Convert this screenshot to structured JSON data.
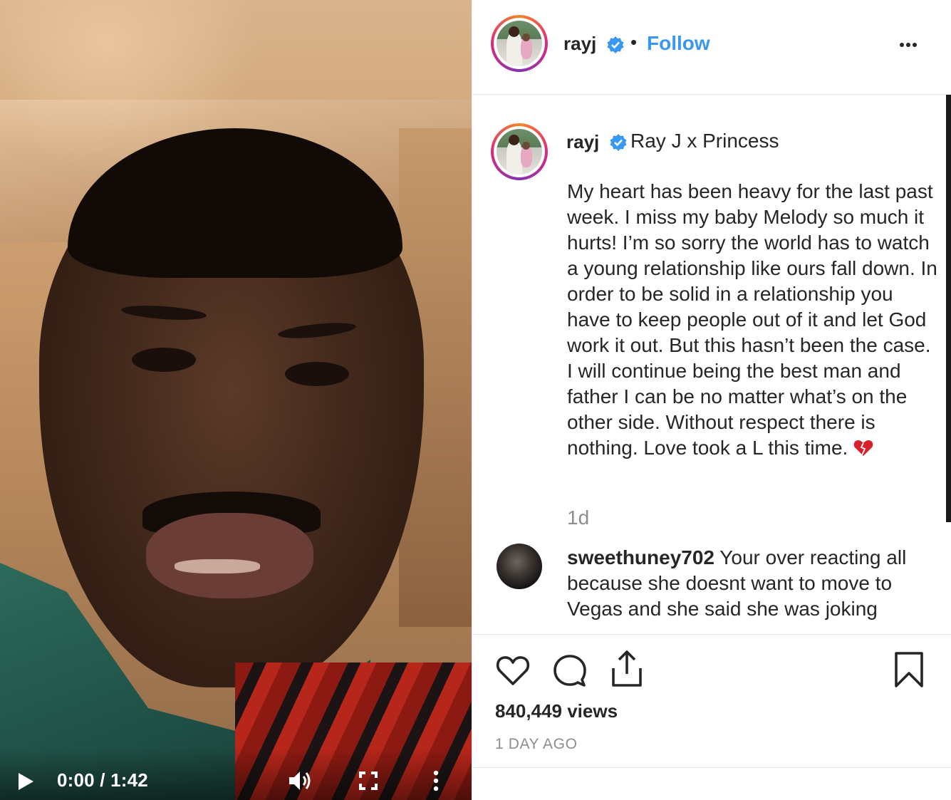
{
  "video": {
    "timecode": "0:00 / 1:42",
    "progress": 0
  },
  "header": {
    "username": "rayj",
    "separator": "•",
    "follow_label": "Follow"
  },
  "caption": {
    "username": "rayj",
    "title": "Ray J x Princess",
    "body": "My heart has been heavy for the last past week. I miss my baby Melody so much it hurts! I’m so sorry the world has to watch a young relationship like ours fall down. In order to be solid in a relationship you have to keep people out of it and let God work it out. But this hasn’t been the case. I will continue being the best man and father I can be no matter what’s on the other side. Without respect there is nothing. Love took a L this time. ",
    "emoji": "broken-heart-icon",
    "time": "1d"
  },
  "comments": [
    {
      "username": "sweethuney702",
      "text": "Your over reacting all because she doesnt want to move to Vegas and she said she was joking"
    }
  ],
  "stats": {
    "views": "840,449 views",
    "posted": "1 DAY AGO"
  },
  "colors": {
    "accent": "#3897f0",
    "text": "#262626",
    "muted": "#8e8e8e",
    "divider": "#e6e6e6"
  }
}
